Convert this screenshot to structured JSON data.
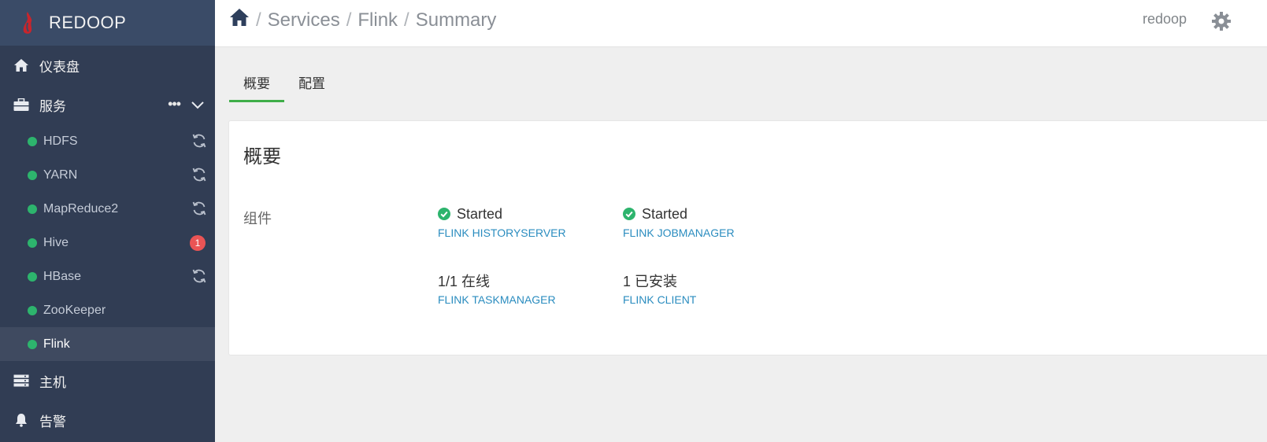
{
  "brand": {
    "name": "REDOOP"
  },
  "nav": {
    "dashboard": "仪表盘",
    "services": "服务",
    "services_more": "•••",
    "hosts": "主机",
    "alerts": "告警"
  },
  "services": [
    {
      "name": "HDFS",
      "indicator": "refresh-icon"
    },
    {
      "name": "YARN",
      "indicator": "refresh-icon"
    },
    {
      "name": "MapReduce2",
      "indicator": "refresh-icon"
    },
    {
      "name": "Hive",
      "badge": "1"
    },
    {
      "name": "HBase",
      "indicator": "refresh-icon"
    },
    {
      "name": "ZooKeeper"
    },
    {
      "name": "Flink",
      "active": true
    }
  ],
  "breadcrumb": {
    "services": "Services",
    "service": "Flink",
    "page": "Summary",
    "sep": "/"
  },
  "header": {
    "user": "redoop"
  },
  "tabs": {
    "summary": "概要",
    "config": "配置"
  },
  "panel": {
    "title": "概要",
    "row_label": "组件",
    "components": [
      {
        "status": "Started",
        "name": "FLINK HISTORYSERVER"
      },
      {
        "status": "Started",
        "name": "FLINK JOBMANAGER"
      },
      {
        "status": "1/1 在线",
        "name": "FLINK TASKMANAGER"
      },
      {
        "status": "1 已安装",
        "name": "FLINK CLIENT"
      }
    ]
  },
  "colors": {
    "sidebar": "#313d54",
    "brand_bar": "#3a4b67",
    "status_green": "#2db46d",
    "link": "#2a8cbf",
    "tab_active": "#3fae49",
    "badge": "#ea5455"
  }
}
